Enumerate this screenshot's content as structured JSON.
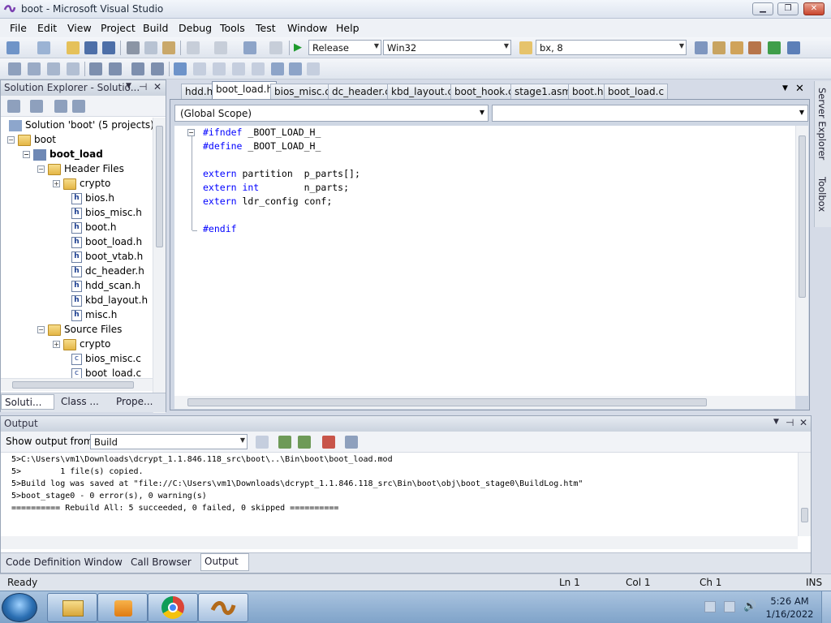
{
  "window": {
    "title": "boot - Microsoft Visual Studio"
  },
  "menu": {
    "items": [
      "File",
      "Edit",
      "View",
      "Project",
      "Build",
      "Debug",
      "Tools",
      "Test",
      "Window",
      "Help"
    ]
  },
  "toolbar": {
    "configuration": "Release",
    "platform": "Win32",
    "find_value": "bx, 8"
  },
  "solution_explorer": {
    "header": "Solution Explorer - Solutio...",
    "tree": {
      "solution": "Solution 'boot' (5 projects)",
      "project_boot": "boot",
      "project_boot_load": "boot_load",
      "header_files": "Header Files",
      "crypto_1": "crypto",
      "files_h": [
        "bios.h",
        "bios_misc.h",
        "boot.h",
        "boot_load.h",
        "boot_vtab.h",
        "dc_header.h",
        "hdd_scan.h",
        "kbd_layout.h",
        "misc.h"
      ],
      "source_files": "Source Files",
      "crypto_2": "crypto",
      "files_c": [
        "bios_misc.c",
        "boot_load.c"
      ]
    },
    "bottom_tabs": [
      "Soluti...",
      "Class ...",
      "Prope..."
    ]
  },
  "editor": {
    "tabs": [
      "hdd.h",
      "boot_load.h",
      "bios_misc.c",
      "dc_header.c",
      "kbd_layout.c",
      "boot_hook.c",
      "stage1.asm",
      "boot.h",
      "boot_load.c"
    ],
    "active_tab": "boot_load.h",
    "scope": "(Global Scope)",
    "code": {
      "l1_kw": "#ifndef",
      "l1_rest": " _BOOT_LOAD_H_",
      "l2_kw": "#define",
      "l2_rest": " _BOOT_LOAD_H_",
      "l4_kw": "extern",
      "l4_rest": " partition  p_parts[];",
      "l5_kw": "extern int",
      "l5_rest": "        n_parts;",
      "l6_kw": "extern",
      "l6_rest": " ldr_config conf;",
      "l8_kw": "#endif"
    }
  },
  "output": {
    "header": "Output",
    "show_from_label": "Show output from:",
    "show_from_value": "Build",
    "lines": [
      "5>C:\\Users\\vm1\\Downloads\\dcrypt_1.1.846.118_src\\boot\\..\\Bin\\boot\\boot_load.mod",
      "5>        1 file(s) copied.",
      "5>Build log was saved at \"file://C:\\Users\\vm1\\Downloads\\dcrypt_1.1.846.118_src\\Bin\\boot\\obj\\boot_stage0\\BuildLog.htm\"",
      "5>boot_stage0 - 0 error(s), 0 warning(s)",
      "========== Rebuild All: 5 succeeded, 0 failed, 0 skipped =========="
    ],
    "bottom_tabs": [
      "Code Definition Window",
      "Call Browser",
      "Output"
    ]
  },
  "right_strip": {
    "tabs": [
      "Server Explorer",
      "Toolbox"
    ]
  },
  "status": {
    "ready": "Ready",
    "ln": "Ln 1",
    "col": "Col 1",
    "ch": "Ch 1",
    "ins": "INS"
  },
  "taskbar": {
    "time": "5:26 AM",
    "date": "1/16/2022"
  },
  "colors": {
    "keyword": "#0000ff",
    "chrome": "#d5dbe7"
  }
}
